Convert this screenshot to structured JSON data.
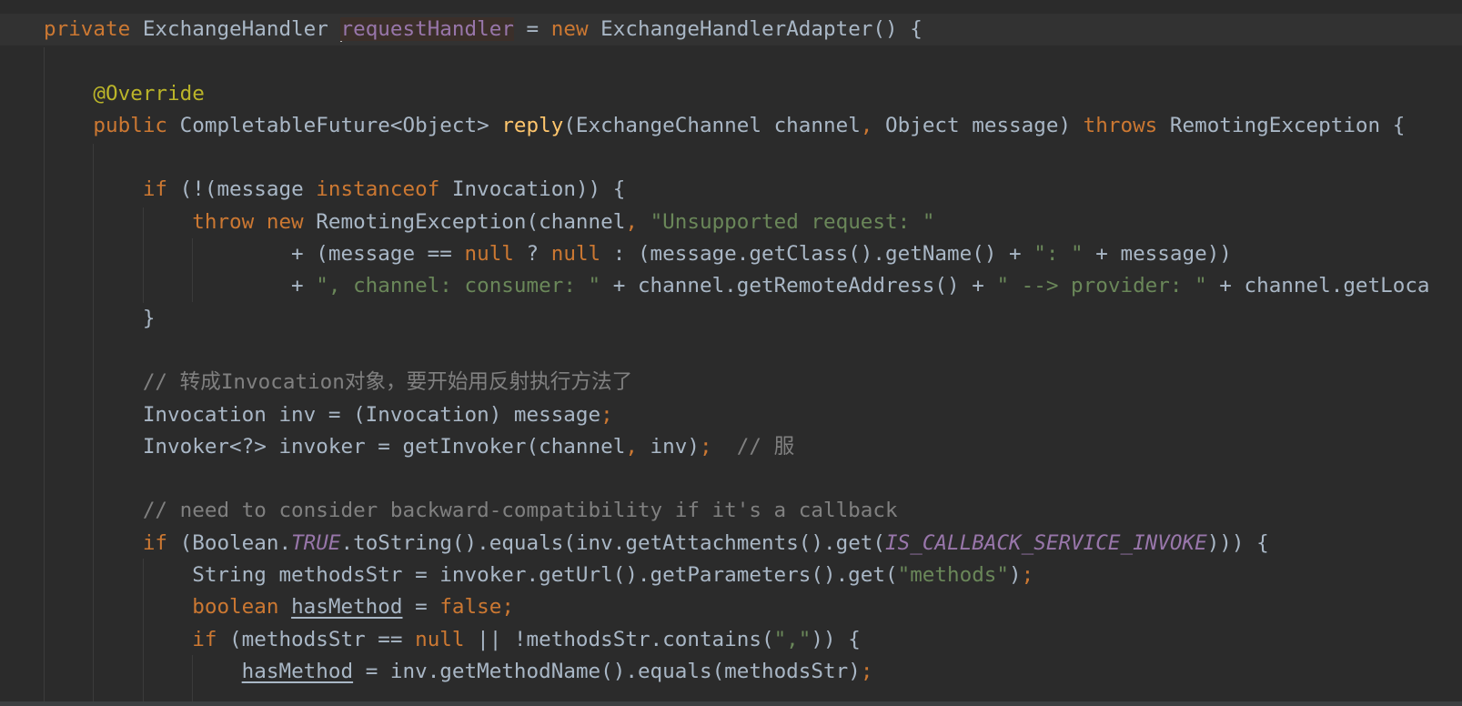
{
  "colors": {
    "background": "#2b2b2b",
    "current_line": "#323232",
    "keyword": "#cc7832",
    "text": "#a9b7c6",
    "annotation": "#bbb529",
    "method": "#ffc66d",
    "string": "#6a8759",
    "comment": "#808080",
    "field": "#9876aa"
  },
  "lines": [
    [
      [
        "k",
        "private "
      ],
      [
        "d",
        "ExchangeHandler "
      ],
      [
        "hl",
        "requestHandler"
      ],
      [
        "d",
        " = "
      ],
      [
        "k",
        "new "
      ],
      [
        "d",
        "ExchangeHandlerAdapter() {"
      ]
    ],
    [],
    [
      [
        "d",
        "    "
      ],
      [
        "a",
        "@Override"
      ]
    ],
    [
      [
        "d",
        "    "
      ],
      [
        "k",
        "public "
      ],
      [
        "d",
        "CompletableFuture<Object> "
      ],
      [
        "m",
        "reply"
      ],
      [
        "d",
        "(ExchangeChannel channel"
      ],
      [
        "k",
        ", "
      ],
      [
        "d",
        "Object message) "
      ],
      [
        "k",
        "throws "
      ],
      [
        "d",
        "RemotingException {"
      ]
    ],
    [],
    [
      [
        "d",
        "        "
      ],
      [
        "k",
        "if "
      ],
      [
        "d",
        "(!(message "
      ],
      [
        "k",
        "instanceof "
      ],
      [
        "d",
        "Invocation)) {"
      ]
    ],
    [
      [
        "d",
        "            "
      ],
      [
        "k",
        "throw new "
      ],
      [
        "d",
        "RemotingException(channel"
      ],
      [
        "k",
        ", "
      ],
      [
        "s",
        "\"Unsupported request: \""
      ]
    ],
    [
      [
        "d",
        "                    + (message == "
      ],
      [
        "k",
        "null "
      ],
      [
        "d",
        "? "
      ],
      [
        "k",
        "null "
      ],
      [
        "d",
        ": (message.getClass().getName() + "
      ],
      [
        "s",
        "\": \""
      ],
      [
        "d",
        " + message))"
      ]
    ],
    [
      [
        "d",
        "                    + "
      ],
      [
        "s",
        "\", channel: consumer: \""
      ],
      [
        "d",
        " + channel.getRemoteAddress() + "
      ],
      [
        "s",
        "\" --> provider: \""
      ],
      [
        "d",
        " + channel.getLoca"
      ]
    ],
    [
      [
        "d",
        "        }"
      ]
    ],
    [],
    [
      [
        "d",
        "        "
      ],
      [
        "c",
        "// 转成Invocation对象，要开始用反射执行方法了"
      ]
    ],
    [
      [
        "d",
        "        Invocation inv = (Invocation) message"
      ],
      [
        "k",
        ";"
      ]
    ],
    [
      [
        "d",
        "        Invoker<?> invoker = getInvoker(channel"
      ],
      [
        "k",
        ", "
      ],
      [
        "d",
        "inv)"
      ],
      [
        "k",
        ";  "
      ],
      [
        "c",
        "// 服"
      ]
    ],
    [],
    [
      [
        "d",
        "        "
      ],
      [
        "c",
        "// need to consider backward-compatibility if it's a callback"
      ]
    ],
    [
      [
        "d",
        "        "
      ],
      [
        "k",
        "if "
      ],
      [
        "d",
        "(Boolean."
      ],
      [
        "fi",
        "TRUE"
      ],
      [
        "d",
        ".toString().equals(inv.getAttachments().get("
      ],
      [
        "fi",
        "IS_CALLBACK_SERVICE_INVOKE"
      ],
      [
        "d",
        "))) {"
      ]
    ],
    [
      [
        "d",
        "            String methodsStr = invoker.getUrl().getParameters().get("
      ],
      [
        "s",
        "\"methods\""
      ],
      [
        "d",
        ")"
      ],
      [
        "k",
        ";"
      ]
    ],
    [
      [
        "d",
        "            "
      ],
      [
        "k",
        "boolean "
      ],
      [
        "u",
        "hasMethod"
      ],
      [
        "d",
        " = "
      ],
      [
        "k",
        "false;"
      ]
    ],
    [
      [
        "d",
        "            "
      ],
      [
        "k",
        "if "
      ],
      [
        "d",
        "(methodsStr == "
      ],
      [
        "k",
        "null "
      ],
      [
        "d",
        "|| !methodsStr.contains("
      ],
      [
        "s",
        "\",\""
      ],
      [
        "d",
        ")) {"
      ]
    ],
    [
      [
        "d",
        "                "
      ],
      [
        "u",
        "hasMethod"
      ],
      [
        "d",
        " = inv.getMethodName().equals(methodsStr)"
      ],
      [
        "k",
        ";"
      ]
    ]
  ]
}
